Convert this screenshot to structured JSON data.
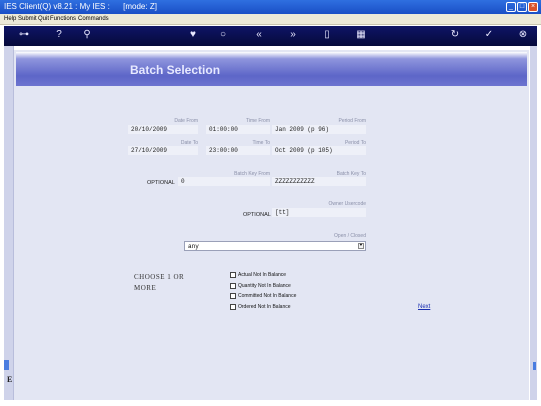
{
  "window": {
    "title": "IES Client(Q) v8.21 : My IES :      [mode: Z]"
  },
  "menu": [
    "Help",
    "Submit",
    "Quit",
    "Functions",
    "Commands"
  ],
  "toolbar_icons": {
    "key": "key-icon",
    "help": "help-icon",
    "search": "search-icon",
    "favorite": "heart-icon",
    "clock": "clock-icon",
    "back": "back-icon",
    "forward": "forward-icon",
    "copy": "copy-icon",
    "grid": "grid-icon",
    "refresh": "refresh-icon",
    "confirm": "check-icon",
    "close": "close-icon"
  },
  "colors": {
    "titlebar": "#1f58d6",
    "toolbar": "#0a0f52",
    "header_band": "#5d66c8",
    "panel": "#e3e6f3",
    "link": "#1a2fb0"
  },
  "page": {
    "title": "Batch Selection"
  },
  "form": {
    "date_from": {
      "label": "Date From",
      "value": "20/10/2009"
    },
    "time_from": {
      "label": "Time From",
      "value": "01:00:00"
    },
    "period_from": {
      "label": "Period From",
      "value": "Jan 2009 (p 96)"
    },
    "date_to": {
      "label": "Date To",
      "value": "27/10/2009"
    },
    "time_to": {
      "label": "Time To",
      "value": "23:00:00"
    },
    "period_to": {
      "label": "Period To",
      "value": "Oct 2009 (p 105)"
    },
    "batch_key_from": {
      "label": "Batch Key From",
      "value": "0",
      "optional": "OPTIONAL"
    },
    "batch_key_to": {
      "label": "Batch Key To",
      "value": "ZZZZZZZZZZZ"
    },
    "owner_usercode": {
      "label": "Owner Usercode",
      "value": "[tt]",
      "optional": "OPTIONAL"
    },
    "open_closed": {
      "label": "Open / Closed",
      "value": "any"
    }
  },
  "choose": {
    "line1": "CHOOSE 1 OR",
    "line2": "MORE",
    "options": [
      {
        "label": "Actual Not In Balance",
        "checked": false
      },
      {
        "label": "Quantity Not In Balance",
        "checked": false
      },
      {
        "label": "Committed Not In Balance",
        "checked": false
      },
      {
        "label": "Ordered Not In Balance",
        "checked": false
      }
    ]
  },
  "next_label": "Next"
}
